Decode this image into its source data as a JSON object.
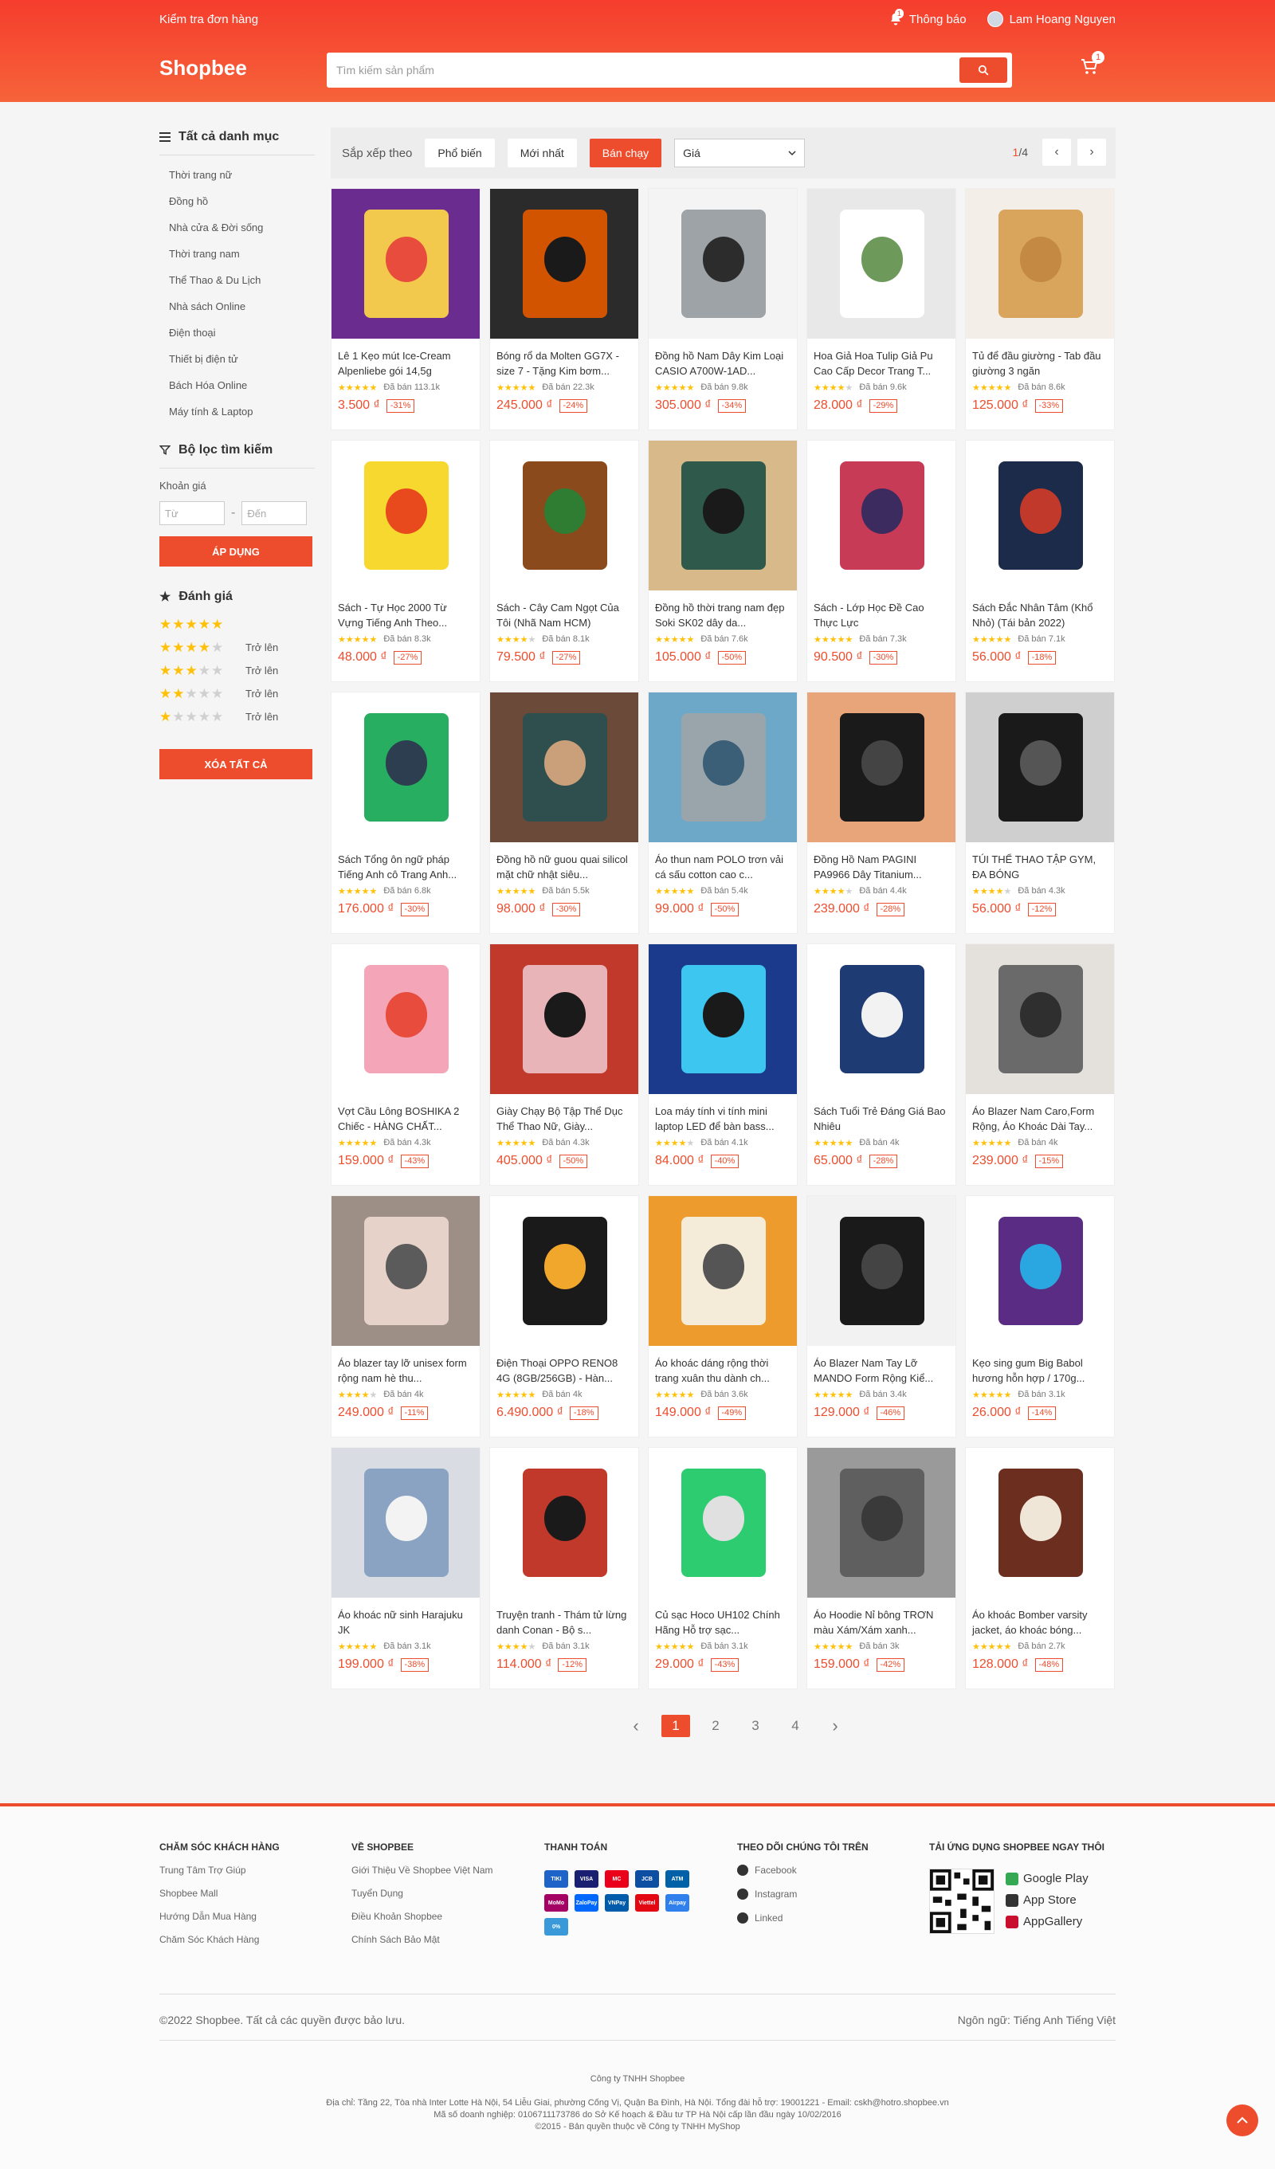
{
  "header": {
    "track_orders": "Kiểm tra đơn hàng",
    "notification_label": "Thông báo",
    "notification_badge": "1",
    "user_name": "Lam Hoang Nguyen",
    "logo": "Shopbee",
    "search_placeholder": "Tìm kiếm sản phẩm",
    "cart_count": "1"
  },
  "sidebar": {
    "categories_title": "Tất cả danh mục",
    "categories": [
      "Thời trang nữ",
      "Đồng hồ",
      "Nhà cửa & Đời sống",
      "Thời trang nam",
      "Thể Thao & Du Lịch",
      "Nhà sách Online",
      "Điện thoại",
      "Thiết bị điện tử",
      "Bách Hóa Online",
      "Máy tính & Laptop"
    ],
    "filter_title": "Bộ lọc tìm kiếm",
    "price_range_label": "Khoản giá",
    "from_placeholder": "Từ",
    "to_placeholder": "Đến",
    "apply_label": "ÁP DỤNG",
    "rating_title": "Đánh giá",
    "rating_up": "Trở lên",
    "ratings": [
      5,
      4,
      3,
      2,
      1
    ],
    "clear_label": "XÓA TẤT CẢ"
  },
  "sort": {
    "label": "Sắp xếp theo",
    "options": [
      "Phổ biến",
      "Mới nhất",
      "Bán chạy"
    ],
    "active_index": 2,
    "price_select": "Giá",
    "page_current": "1",
    "page_total": "/4"
  },
  "products": [
    {
      "name": "Lê 1 Kẹo mút Ice-Cream Alpenliebe gói 14,5g",
      "stars": 5,
      "sold": "Đã bán 113.1k",
      "price": "3.500 ₫",
      "discount": "-31%",
      "colors": [
        "#6a2d8f",
        "#f2c94c",
        "#e74c3c"
      ]
    },
    {
      "name": "Bóng rổ da Molten GG7X - size 7 - Tặng Kim bơm...",
      "stars": 5,
      "sold": "Đã bán 22.3k",
      "price": "245.000 ₫",
      "discount": "-24%",
      "colors": [
        "#2b2b2b",
        "#d35400",
        "#1a1a1a"
      ]
    },
    {
      "name": "Đồng hồ Nam Dây Kim Loại CASIO A700W-1AD...",
      "stars": 5,
      "sold": "Đã bán 9.8k",
      "price": "305.000 ₫",
      "discount": "-34%",
      "colors": [
        "#f4f4f4",
        "#9ea3a8",
        "#2c2c2c"
      ]
    },
    {
      "name": "Hoa Giả Hoa Tulip Giả Pu Cao Cấp Decor Trang T...",
      "stars": 4,
      "sold": "Đã bán 9.6k",
      "price": "28.000 ₫",
      "discount": "-29%",
      "colors": [
        "#e8e8e8",
        "#ffffff",
        "#6d9a5a"
      ]
    },
    {
      "name": "Tủ để đầu giường - Tab đầu giường 3 ngăn",
      "stars": 5,
      "sold": "Đã bán 8.6k",
      "price": "125.000 ₫",
      "discount": "-33%",
      "colors": [
        "#f3efe8",
        "#d9a45c",
        "#c48a43"
      ]
    },
    {
      "name": "Sách - Tự Học 2000 Từ Vựng Tiếng Anh Theo...",
      "stars": 5,
      "sold": "Đã bán 8.3k",
      "price": "48.000 ₫",
      "discount": "-27%",
      "colors": [
        "#ffffff",
        "#f7d82f",
        "#e84a1e"
      ]
    },
    {
      "name": "Sách - Cây Cam Ngọt Của Tôi (Nhã Nam HCM)",
      "stars": 4,
      "sold": "Đã bán 8.1k",
      "price": "79.500 ₫",
      "discount": "-27%",
      "colors": [
        "#ffffff",
        "#8a4a1c",
        "#2e7d32"
      ]
    },
    {
      "name": "Đồng hồ thời trang nam đẹp Soki SK02 dây da...",
      "stars": 5,
      "sold": "Đã bán 7.6k",
      "price": "105.000 ₫",
      "discount": "-50%",
      "colors": [
        "#d8b98a",
        "#2f5a4b",
        "#1a1a1a"
      ]
    },
    {
      "name": "Sách - Lớp Học Đề Cao Thực Lực",
      "stars": 5,
      "sold": "Đã bán 7.3k",
      "price": "90.500 ₫",
      "discount": "-30%",
      "colors": [
        "#ffffff",
        "#c83b57",
        "#3b2b5e"
      ]
    },
    {
      "name": "Sách Đắc Nhân Tâm (Khổ Nhỏ) (Tái bản 2022)",
      "stars": 5,
      "sold": "Đã bán 7.1k",
      "price": "56.000 ₫",
      "discount": "-18%",
      "colors": [
        "#ffffff",
        "#1c2b4a",
        "#c0392b"
      ]
    },
    {
      "name": "Sách Tổng ôn ngữ pháp Tiếng Anh cô Trang Anh...",
      "stars": 5,
      "sold": "Đã bán 6.8k",
      "price": "176.000 ₫",
      "discount": "-30%",
      "colors": [
        "#ffffff",
        "#27ae60",
        "#2c3e50"
      ]
    },
    {
      "name": "Đồng hồ nữ guou quai silicol mặt chữ nhật siêu...",
      "stars": 5,
      "sold": "Đã bán 5.5k",
      "price": "98.000 ₫",
      "discount": "-30%",
      "colors": [
        "#6b4a3a",
        "#2f4f4f",
        "#c9a07a"
      ]
    },
    {
      "name": "Áo thun nam POLO trơn vải cá sấu cotton cao c...",
      "stars": 5,
      "sold": "Đã bán 5.4k",
      "price": "99.000 ₫",
      "discount": "-50%",
      "colors": [
        "#6ea8c8",
        "#9aa5ab",
        "#3c5f78"
      ]
    },
    {
      "name": "Đồng Hồ Nam PAGINI PA9966 Dây Titanium...",
      "stars": 4,
      "sold": "Đã bán 4.4k",
      "price": "239.000 ₫",
      "discount": "-28%",
      "colors": [
        "#e9a57a",
        "#1a1a1a",
        "#444444"
      ]
    },
    {
      "name": "TÚI THỂ THAO TẬP GYM, ĐA BÓNG",
      "stars": 4,
      "sold": "Đã bán 4.3k",
      "price": "56.000 ₫",
      "discount": "-12%",
      "colors": [
        "#cfcfcf",
        "#1a1a1a",
        "#555555"
      ]
    },
    {
      "name": "Vợt Cầu Lông BOSHIKA 2 Chiếc - HÀNG CHẤT...",
      "stars": 5,
      "sold": "Đã bán 4.3k",
      "price": "159.000 ₫",
      "discount": "-43%",
      "colors": [
        "#ffffff",
        "#f4a6b8",
        "#e74c3c"
      ]
    },
    {
      "name": "Giày Chạy Bộ Tập Thể Dục Thể Thao Nữ, Giày...",
      "stars": 5,
      "sold": "Đã bán 4.3k",
      "price": "405.000 ₫",
      "discount": "-50%",
      "colors": [
        "#c0392b",
        "#e8b4b8",
        "#1a1a1a"
      ]
    },
    {
      "name": "Loa máy tính vi tính mini laptop LED để bàn bass...",
      "stars": 4,
      "sold": "Đã bán 4.1k",
      "price": "84.000 ₫",
      "discount": "-40%",
      "colors": [
        "#1b3a8c",
        "#3cc6f0",
        "#1a1a1a"
      ]
    },
    {
      "name": "Sách Tuổi Trẻ Đáng Giá Bao Nhiêu",
      "stars": 5,
      "sold": "Đã bán 4k",
      "price": "65.000 ₫",
      "discount": "-28%",
      "colors": [
        "#ffffff",
        "#1f3b73",
        "#f2f2f2"
      ]
    },
    {
      "name": "Áo Blazer Nam Caro,Form Rộng, Áo Khoác Dài Tay...",
      "stars": 5,
      "sold": "Đã bán 4k",
      "price": "239.000 ₫",
      "discount": "-15%",
      "colors": [
        "#e4e1dc",
        "#6a6a6a",
        "#2f2f2f"
      ]
    },
    {
      "name": "Áo blazer tay lỡ unisex form rộng nam hè thu...",
      "stars": 4,
      "sold": "Đã bán 4k",
      "price": "249.000 ₫",
      "discount": "-11%",
      "colors": [
        "#9e8f86",
        "#e6d2c8",
        "#5b5b5b"
      ]
    },
    {
      "name": "Điện Thoại OPPO RENO8 4G (8GB/256GB) - Hàn...",
      "stars": 5,
      "sold": "Đã bán 4k",
      "price": "6.490.000 ₫",
      "discount": "-18%",
      "colors": [
        "#ffffff",
        "#1a1a1a",
        "#f0a72c"
      ]
    },
    {
      "name": "Áo khoác dáng rộng thời trang xuân thu dành ch...",
      "stars": 5,
      "sold": "Đã bán 3.6k",
      "price": "149.000 ₫",
      "discount": "-49%",
      "colors": [
        "#ed9b2c",
        "#f4ecd8",
        "#555555"
      ]
    },
    {
      "name": "Áo Blazer Nam Tay Lỡ MANDO Form Rộng Kiể...",
      "stars": 5,
      "sold": "Đã bán 3.4k",
      "price": "129.000 ₫",
      "discount": "-46%",
      "colors": [
        "#f2f2f2",
        "#1a1a1a",
        "#444444"
      ]
    },
    {
      "name": "Kẹo sing gum Big Babol hương hỗn hợp / 170g...",
      "stars": 5,
      "sold": "Đã bán 3.1k",
      "price": "26.000 ₫",
      "discount": "-14%",
      "colors": [
        "#ffffff",
        "#5b2c83",
        "#2aa7e0"
      ]
    },
    {
      "name": "Áo khoác nữ sinh Harajuku JK",
      "stars": 5,
      "sold": "Đã bán 3.1k",
      "price": "199.000 ₫",
      "discount": "-38%",
      "colors": [
        "#d9dde3",
        "#8aa3c2",
        "#f3f3f3"
      ]
    },
    {
      "name": "Truyện tranh - Thám tử lừng danh Conan - Bộ s...",
      "stars": 4,
      "sold": "Đã bán 3.1k",
      "price": "114.000 ₫",
      "discount": "-12%",
      "colors": [
        "#ffffff",
        "#c0392b",
        "#1a1a1a"
      ]
    },
    {
      "name": "Củ sạc Hoco UH102 Chính Hãng Hỗ trợ sạc...",
      "stars": 5,
      "sold": "Đã bán 3.1k",
      "price": "29.000 ₫",
      "discount": "-43%",
      "colors": [
        "#ffffff",
        "#2ecc71",
        "#e0e0e0"
      ]
    },
    {
      "name": "Áo Hoodie Nỉ bông TRƠN màu Xám/Xám xanh...",
      "stars": 5,
      "sold": "Đã bán 3k",
      "price": "159.000 ₫",
      "discount": "-42%",
      "colors": [
        "#9a9a9a",
        "#5f5f5f",
        "#3a3a3a"
      ]
    },
    {
      "name": "Áo khoác Bomber varsity jacket, áo khoác bóng...",
      "stars": 5,
      "sold": "Đã bán 2.7k",
      "price": "128.000 ₫",
      "discount": "-48%",
      "colors": [
        "#ffffff",
        "#6b2e1f",
        "#f0e6d8"
      ]
    }
  ],
  "pagination": {
    "pages": [
      "1",
      "2",
      "3",
      "4"
    ],
    "active_index": 0
  },
  "footer": {
    "customer_care_title": "CHĂM SÓC KHÁCH HÀNG",
    "customer_care_links": [
      "Trung Tâm Trợ Giúp",
      "Shopbee Mall",
      "Hướng Dẫn Mua Hàng",
      "Chăm Sóc Khách Hàng"
    ],
    "about_title": "VỀ SHOPBEE",
    "about_links": [
      "Giới Thiệu Về Shopbee Việt Nam",
      "Tuyển Dụng",
      "Điều Khoản Shopbee",
      "Chính Sách Bảo Mật"
    ],
    "payment_title": "THANH TOÁN",
    "payment_methods": [
      "TIKI",
      "VISA",
      "MC",
      "JCB",
      "ATM",
      "MoMo",
      "ZaloPay",
      "VNPay",
      "Viettel",
      "Airpay",
      "0%"
    ],
    "follow_title": "THEO DÕI CHÚNG TÔI TRÊN",
    "follow_links": [
      "Facebook",
      "Instagram",
      "Linked"
    ],
    "app_title": "TẢI ỨNG DỤNG SHOPBEE NGAY THÔI",
    "stores": [
      "Google Play",
      "App Store",
      "AppGallery"
    ],
    "copyright": "©2022 Shopbee. Tất cả các quyền được bảo lưu.",
    "language": "Ngôn ngữ: Tiếng Anh Tiếng Việt",
    "company": "Công ty TNHH Shopbee",
    "address": "Địa chỉ: Tầng 22, Tòa nhà Inter Lotte Hà Nội, 54 Liễu Giai, phường Cống Vị, Quận Ba Đình, Hà Nội. Tổng đài hỗ trợ: 19001221 - Email: cskh@hotro.shopbee.vn",
    "business_id": "Mã số doanh nghiệp: 0106711173786 do Sở Kế hoạch & Đầu tư TP Hà Nội cấp lần đầu ngày 10/02/2016",
    "rights": "©2015 - Bản quyền thuộc về Công ty TNHH MyShop"
  },
  "accent_color": "#ee4d2d"
}
